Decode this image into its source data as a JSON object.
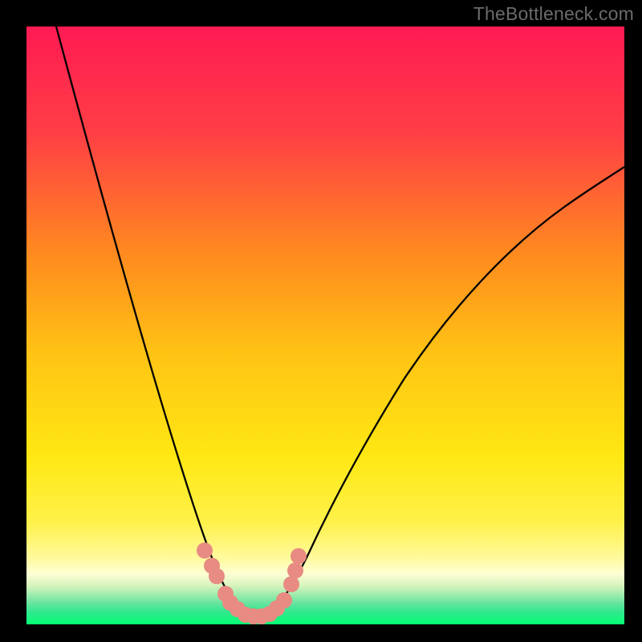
{
  "watermark": "TheBottleneck.com",
  "chart_data": {
    "type": "line",
    "title": "",
    "xlabel": "",
    "ylabel": "",
    "xlim": [
      0,
      100
    ],
    "ylim": [
      0,
      100
    ],
    "gradient_colors": {
      "top": "#ff1a53",
      "upper_mid": "#ff8a1f",
      "mid": "#ffe813",
      "lower_mid": "#fff9a8",
      "bottom_1": "#d3f3b6",
      "bottom_2": "#6ee0a0",
      "bottom_3": "#14e57b",
      "bottom_4": "#00ff72"
    },
    "series": [
      {
        "name": "left-branch",
        "x": [
          5,
          7,
          10,
          13,
          16,
          19,
          22,
          25,
          27,
          29,
          30.5,
          32,
          33.5,
          35,
          36
        ],
        "y": [
          100,
          92,
          82,
          72,
          62,
          52,
          42,
          32,
          24,
          17,
          12,
          8.5,
          5.8,
          3.5,
          2.0
        ]
      },
      {
        "name": "right-branch",
        "x": [
          41,
          43,
          46,
          50,
          54,
          58,
          63,
          68,
          74,
          80,
          86,
          92,
          98,
          100
        ],
        "y": [
          2.0,
          4.0,
          8.0,
          14,
          21,
          28,
          36,
          44,
          52,
          60,
          66,
          71,
          75,
          77
        ]
      },
      {
        "name": "valley-markers",
        "type": "scatter",
        "color": "#e88b82",
        "points": [
          {
            "x": 30.0,
            "y": 12.0
          },
          {
            "x": 31.3,
            "y": 9.3
          },
          {
            "x": 32.0,
            "y": 7.8
          },
          {
            "x": 33.5,
            "y": 4.7
          },
          {
            "x": 34.3,
            "y": 3.3
          },
          {
            "x": 35.5,
            "y": 2.3
          },
          {
            "x": 36.7,
            "y": 1.4
          },
          {
            "x": 38.0,
            "y": 1.2
          },
          {
            "x": 39.3,
            "y": 1.3
          },
          {
            "x": 40.7,
            "y": 1.7
          },
          {
            "x": 42.0,
            "y": 2.6
          },
          {
            "x": 43.3,
            "y": 4.0
          },
          {
            "x": 44.5,
            "y": 6.7
          },
          {
            "x": 45.0,
            "y": 9.0
          },
          {
            "x": 45.7,
            "y": 11.5
          }
        ]
      }
    ]
  }
}
